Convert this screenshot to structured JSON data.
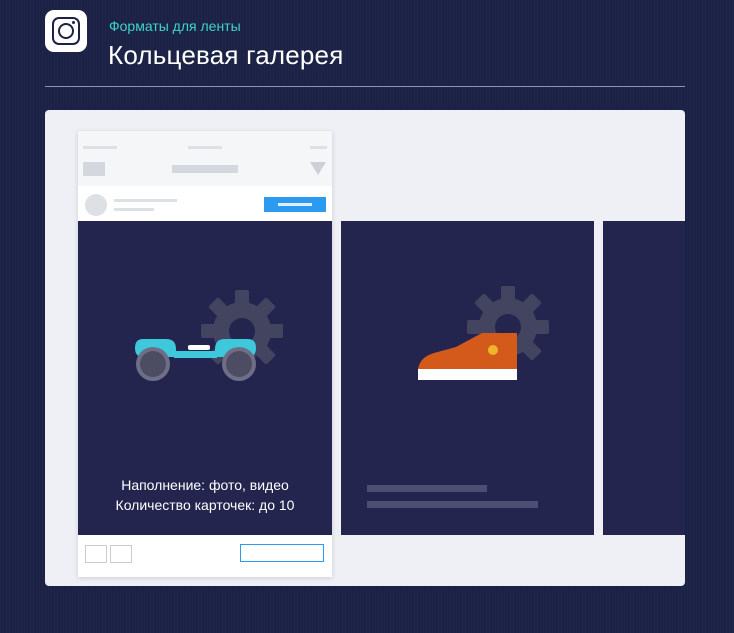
{
  "header": {
    "logo_icon": "instagram-icon",
    "subtitle": "Форматы для ленты",
    "title": "Кольцевая галерея"
  },
  "colors": {
    "background": "#1c2146",
    "accent": "#3dd6c4",
    "card": "#24254f",
    "button": "#2a9bf0",
    "panel": "#eef0f5"
  },
  "card1": {
    "illustration": "hoverboard-with-gear-icon",
    "line1": "Наполнение: фото, видео",
    "line2": "Количество карточек: до 10"
  },
  "card2": {
    "illustration": "sneaker-with-gear-icon"
  }
}
